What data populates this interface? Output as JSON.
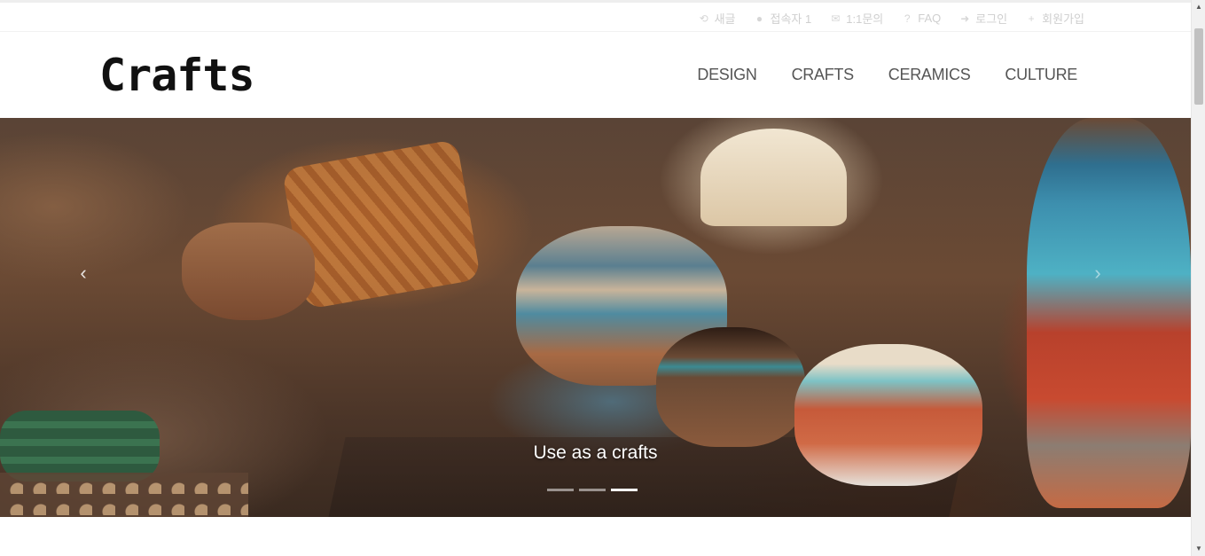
{
  "topbar": {
    "links": [
      {
        "icon": "history-icon",
        "glyph": "⟲",
        "label": "새글"
      },
      {
        "icon": "users-icon",
        "glyph": "●",
        "label": "접속자 1"
      },
      {
        "icon": "chat-icon",
        "glyph": "✉",
        "label": "1:1문의"
      },
      {
        "icon": "question-icon",
        "glyph": "?",
        "label": "FAQ"
      },
      {
        "icon": "login-icon",
        "glyph": "➜",
        "label": "로그인"
      },
      {
        "icon": "user-plus-icon",
        "glyph": "+",
        "label": "회원가입"
      }
    ]
  },
  "header": {
    "logo": "Crafts",
    "nav": [
      "DESIGN",
      "CRAFTS",
      "CERAMICS",
      "CULTURE"
    ]
  },
  "hero": {
    "caption": "Use as a crafts",
    "prev_glyph": "‹",
    "next_glyph": "›",
    "slide_count": 3,
    "active_slide": 3
  },
  "scrollbar": {
    "up_glyph": "▲",
    "down_glyph": "▼"
  }
}
